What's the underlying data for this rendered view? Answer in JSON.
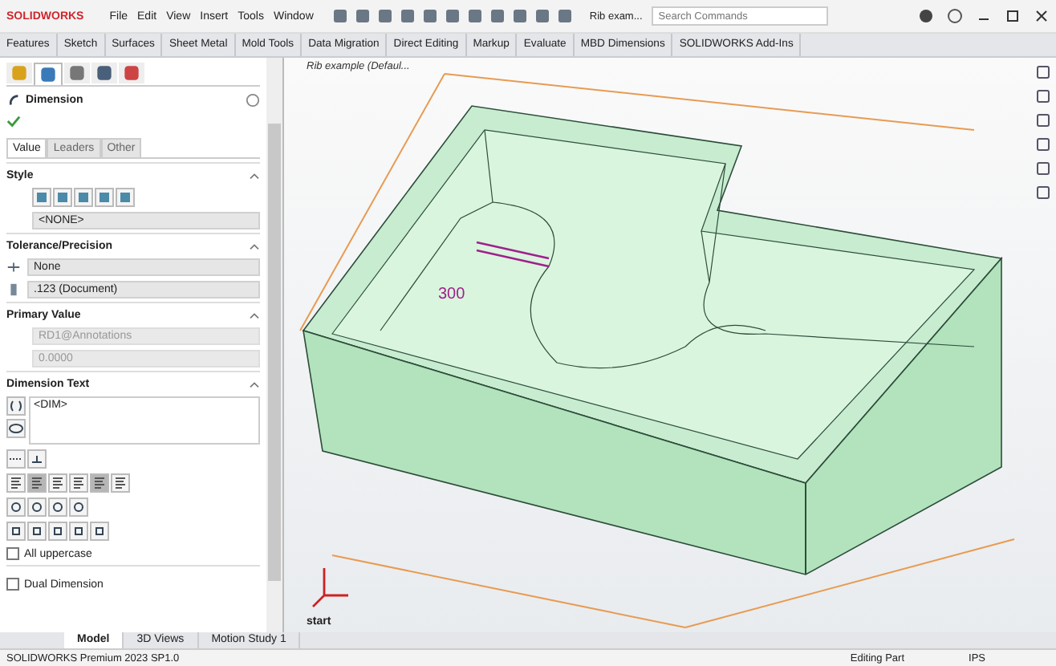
{
  "app": {
    "logo": "SOLIDWORKS",
    "menu": [
      "File",
      "Edit",
      "View",
      "Insert",
      "Tools",
      "Window"
    ],
    "document_title": "Rib exam...",
    "search": {
      "placeholder": "Search Commands"
    }
  },
  "command_tabs": [
    {
      "label": "Features",
      "selected": false
    },
    {
      "label": "Sketch",
      "selected": false
    },
    {
      "label": "Surfaces",
      "selected": false
    },
    {
      "label": "Sheet Metal",
      "selected": false
    },
    {
      "label": "Mold Tools",
      "selected": false
    },
    {
      "label": "Data Migration",
      "selected": false
    },
    {
      "label": "Direct Editing",
      "selected": false
    },
    {
      "label": "Markup",
      "selected": false
    },
    {
      "label": "Evaluate",
      "selected": false
    },
    {
      "label": "MBD Dimensions",
      "selected": false
    },
    {
      "label": "SOLIDWORKS Add-Ins",
      "selected": false
    }
  ],
  "panel": {
    "manager_tabs": [
      {
        "selected": false
      },
      {
        "selected": true
      },
      {
        "selected": false
      },
      {
        "selected": false
      },
      {
        "selected": false
      }
    ],
    "title": "Dimension",
    "subtabs": [
      {
        "label": "Value",
        "selected": true
      },
      {
        "label": "Leaders",
        "selected": false
      },
      {
        "label": "Other",
        "selected": false
      }
    ],
    "style": {
      "heading": "Style",
      "dropdown": "<NONE>"
    },
    "tolerance": {
      "heading": "Tolerance/Precision",
      "tolerance": "None",
      "precision": ".123 (Document)"
    },
    "primary": {
      "heading": "Primary Value",
      "name": "RD1@Annotations",
      "value": "0.0000",
      "disabled": true
    },
    "dimension_text": {
      "heading": "Dimension Text",
      "text": "<DIM>"
    },
    "justify": [
      {
        "selected": false
      },
      {
        "selected": true
      },
      {
        "selected": false
      },
      {
        "selected": false
      },
      {
        "selected": true
      },
      {
        "selected": false
      }
    ],
    "all_uppercase": {
      "label": "All uppercase",
      "checked": false
    },
    "dual_dimension": {
      "label": "Dual Dimension",
      "checked": false
    }
  },
  "viewport": {
    "tree_flyout": "Rib example (Defaul...",
    "dimension_label": "300",
    "origin_label": "start"
  },
  "bottom_tabs": [
    {
      "label": "Model",
      "selected": true
    },
    {
      "label": "3D Views",
      "selected": false
    },
    {
      "label": "Motion Study 1",
      "selected": false
    }
  ],
  "status_bar": {
    "product": "SOLIDWORKS Premium 2023 SP1.0",
    "mode": "Editing Part",
    "units": "IPS"
  }
}
